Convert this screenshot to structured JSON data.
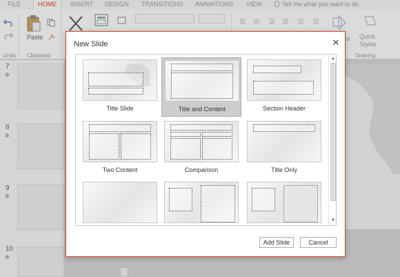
{
  "ribbon": {
    "tabs": [
      {
        "label": "FILE",
        "active": false
      },
      {
        "label": "HOME",
        "active": true
      },
      {
        "label": "INSERT",
        "active": false
      },
      {
        "label": "DESIGN",
        "active": false
      },
      {
        "label": "TRANSITIONS",
        "active": false
      },
      {
        "label": "ANIMATIONS",
        "active": false
      },
      {
        "label": "VIEW",
        "active": false
      }
    ],
    "tell_me": "Tell me what you want to do",
    "paste_label": "Paste",
    "shapes_label": "es",
    "quick_styles_label": "Quick\nStyles",
    "groups": {
      "undo": "Undo",
      "clipboard": "Clipboard",
      "drawing": "Drawing"
    },
    "accent_color": "#d24726"
  },
  "slides_pane": {
    "slides": [
      {
        "number": "7"
      },
      {
        "number": "8"
      },
      {
        "number": "9"
      },
      {
        "number": "10"
      }
    ]
  },
  "dialog": {
    "title": "New Slide",
    "layouts": [
      {
        "name": "Title Slide",
        "selected": false
      },
      {
        "name": "Title and Content",
        "selected": true
      },
      {
        "name": "Section Header",
        "selected": false
      },
      {
        "name": "Two Content",
        "selected": false
      },
      {
        "name": "Comparison",
        "selected": false
      },
      {
        "name": "Title Only",
        "selected": false
      },
      {
        "name": "",
        "selected": false
      },
      {
        "name": "",
        "selected": false
      },
      {
        "name": "",
        "selected": false
      }
    ],
    "add_button": "Add Slide",
    "cancel_button": "Cancel"
  }
}
